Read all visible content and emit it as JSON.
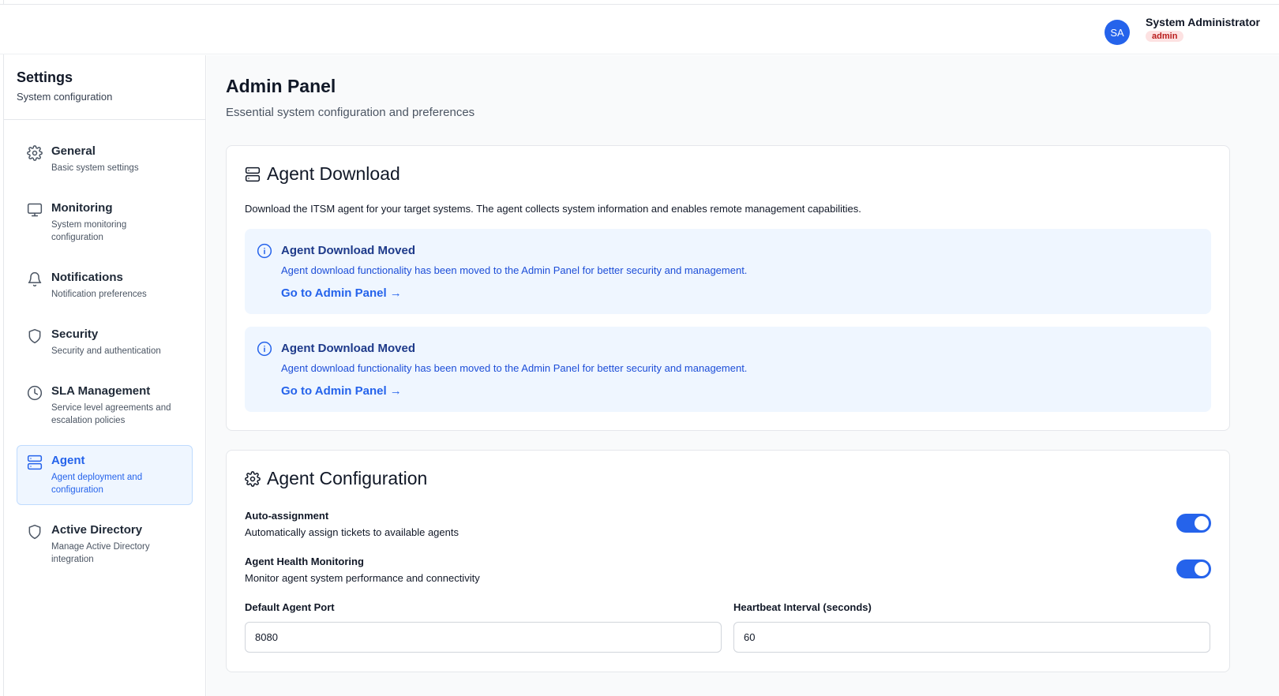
{
  "header": {
    "avatar_initials": "SA",
    "user_name": "System Administrator",
    "user_role": "admin"
  },
  "sidebar": {
    "title": "Settings",
    "subtitle": "System configuration",
    "items": [
      {
        "label": "General",
        "description": "Basic system settings",
        "icon": "gear-icon"
      },
      {
        "label": "Monitoring",
        "description": "System monitoring configuration",
        "icon": "monitor-icon"
      },
      {
        "label": "Notifications",
        "description": "Notification preferences",
        "icon": "bell-icon"
      },
      {
        "label": "Security",
        "description": "Security and authentication",
        "icon": "shield-icon"
      },
      {
        "label": "SLA Management",
        "description": "Service level agreements and escalation policies",
        "icon": "clock-icon"
      },
      {
        "label": "Agent",
        "description": "Agent deployment and configuration",
        "icon": "server-icon",
        "active": true
      },
      {
        "label": "Active Directory",
        "description": "Manage Active Directory integration",
        "icon": "shield-icon"
      }
    ]
  },
  "main": {
    "title": "Admin Panel",
    "subtitle": "Essential system configuration and preferences",
    "download_card": {
      "title": "Agent Download",
      "description": "Download the ITSM agent for your target systems. The agent collects system information and enables remote management capabilities.",
      "alerts": [
        {
          "title": "Agent Download Moved",
          "text": "Agent download functionality has been moved to the Admin Panel for better security and management.",
          "link": "Go to Admin Panel →"
        },
        {
          "title": "Agent Download Moved",
          "text": "Agent download functionality has been moved to the Admin Panel for better security and management.",
          "link": "Go to Admin Panel →"
        }
      ]
    },
    "config_card": {
      "title": "Agent Configuration",
      "toggles": [
        {
          "label": "Auto-assignment",
          "description": "Automatically assign tickets to available agents",
          "enabled": true
        },
        {
          "label": "Agent Health Monitoring",
          "description": "Monitor agent system performance and connectivity",
          "enabled": true
        }
      ],
      "fields": [
        {
          "label": "Default Agent Port",
          "value": "8080"
        },
        {
          "label": "Heartbeat Interval (seconds)",
          "value": "60"
        }
      ]
    }
  },
  "colors": {
    "accent": "#2563eb",
    "active_bg": "#eff6ff",
    "badge_bg": "#fde2e2",
    "badge_text": "#b91c1c"
  }
}
